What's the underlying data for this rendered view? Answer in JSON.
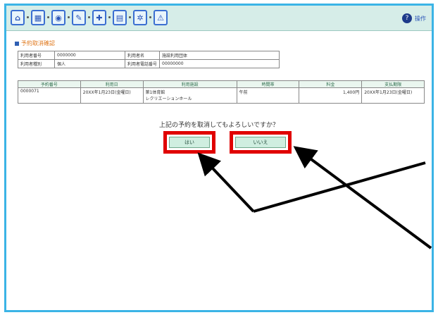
{
  "toolbar": {
    "buttons": [
      {
        "icon": "home-icon",
        "glyph": "⌂"
      },
      {
        "icon": "calendar-icon",
        "glyph": "▦"
      },
      {
        "icon": "search-icon",
        "glyph": "◉"
      },
      {
        "icon": "edit-icon",
        "glyph": "✎"
      },
      {
        "icon": "tools-icon",
        "glyph": "✚"
      },
      {
        "icon": "print-icon",
        "glyph": "▤"
      },
      {
        "icon": "settings-icon",
        "glyph": "✲"
      },
      {
        "icon": "warning-icon",
        "glyph": "⚠"
      }
    ],
    "help_label": "操作"
  },
  "page_title": "予約取消確認",
  "info": {
    "row1": {
      "label1": "利用者番号",
      "value1": "0000000",
      "label2": "利用者名",
      "value2": "施設利用団体"
    },
    "row2": {
      "label1": "利用者種別",
      "value1": "個人",
      "label2": "利用者電話番号",
      "value2": "00000000"
    }
  },
  "reservation_table": {
    "headers": [
      "予約番号",
      "利用日",
      "利用施設",
      "時間帯",
      "料金",
      "支払期限"
    ],
    "rows": [
      {
        "number": "0000071",
        "date": "20XX年1月23日(金曜日)",
        "facility": "第1体育館",
        "facility_sub": "レクリエーションホール",
        "time": "午前",
        "fee": "1,400円",
        "deadline": "20XX年1月23日(金曜日)"
      }
    ]
  },
  "question": "上記の予約を取消してもよろしいですか？",
  "buttons": {
    "yes": "はい",
    "no": "いいえ"
  },
  "colors": {
    "frame": "#3bb4e6",
    "highlight": "#e00000",
    "toolbar": "#d6ede8"
  }
}
